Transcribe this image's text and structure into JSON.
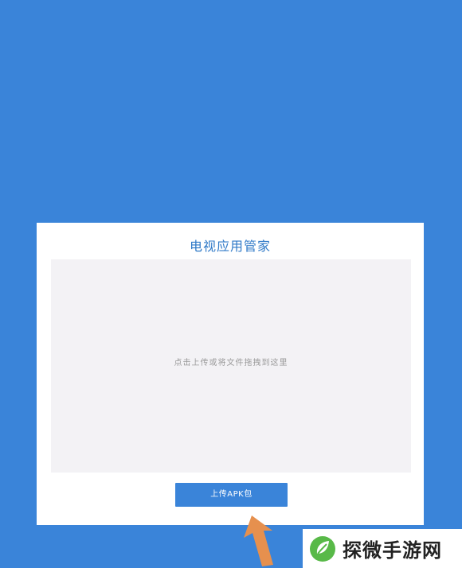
{
  "app": {
    "title": "电视应用管家"
  },
  "upload_area": {
    "hint": "点击上传或将文件拖拽到这里"
  },
  "upload_button": {
    "label": "上传APK包"
  },
  "watermark": {
    "text": "探微手游网",
    "logo_icon": "leaf-logo-icon"
  },
  "colors": {
    "page_background": "#3a84d9",
    "card_background": "#ffffff",
    "drop_zone_background": "#f3f2f5",
    "title": "#2f79c7",
    "button": "#3a84d9",
    "arrow": "#e6904e",
    "watermark_logo": "#58b948"
  },
  "icons": {
    "pointer": "arrow-pointer-icon"
  }
}
